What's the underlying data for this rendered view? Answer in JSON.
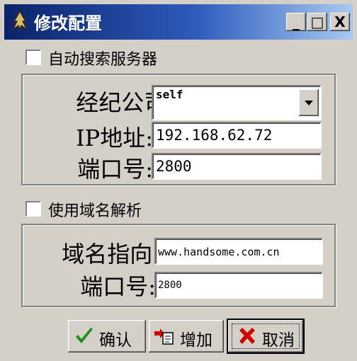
{
  "window": {
    "title": "修改配置",
    "minimize_glyph": "_",
    "maximize_glyph": "□",
    "close_glyph": "X"
  },
  "auto_search": {
    "label": "自动搜索服务器",
    "checked": false
  },
  "server_group": {
    "broker_label": "经纪公司:",
    "broker_value": "self",
    "ip_label": "IP地址:",
    "ip_value": "192.168.62.72",
    "port_label": "端口号:",
    "port_value": "2800"
  },
  "domain_option": {
    "label": "使用域名解析",
    "checked": false
  },
  "domain_group": {
    "domain_label": "域名指向:",
    "domain_value": "www.handsome.com.cn",
    "port_label": "端口号:",
    "port_value": "2800"
  },
  "buttons": {
    "confirm": "确认",
    "add": "增加",
    "cancel": "取消"
  },
  "colors": {
    "titlebar_start": "#0a246a",
    "titlebar_end": "#a6caf0",
    "face": "#d4d0c8",
    "confirm_check": "#1a8f1a",
    "cancel_x": "#d40000"
  }
}
